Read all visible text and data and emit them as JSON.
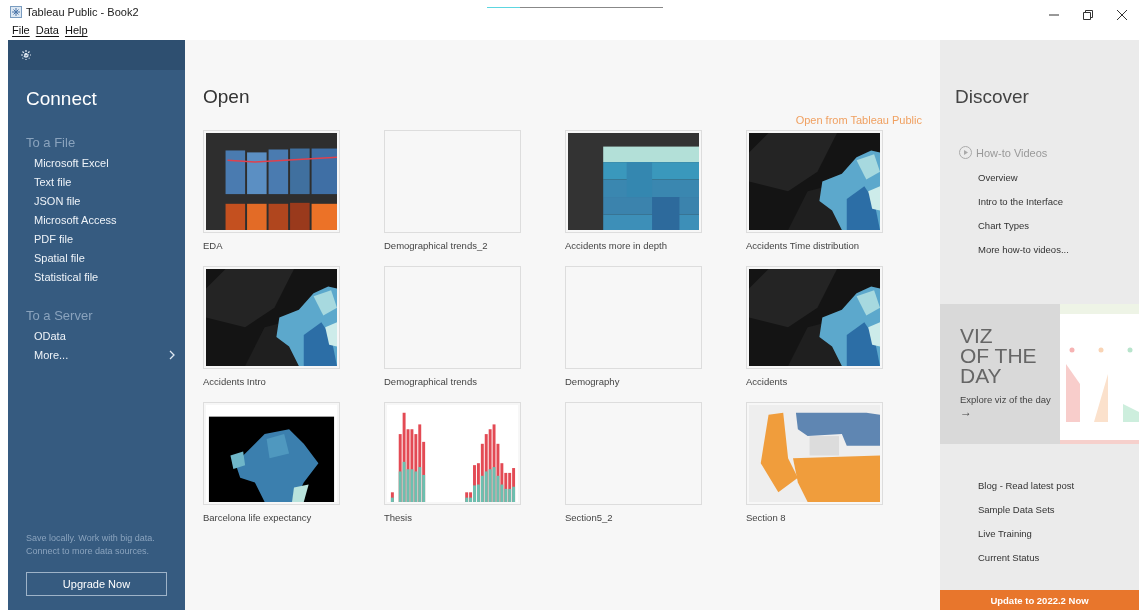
{
  "window": {
    "title": "Tableau Public - Book2"
  },
  "menu": [
    "File",
    "Data",
    "Help"
  ],
  "loading_bar": {
    "level": 0.19
  },
  "connect": {
    "title": "Connect",
    "sections": [
      {
        "heading": "To a File",
        "items": [
          {
            "label": "Microsoft Excel",
            "has_submenu": false
          },
          {
            "label": "Text file",
            "has_submenu": false
          },
          {
            "label": "JSON file",
            "has_submenu": false
          },
          {
            "label": "Microsoft Access",
            "has_submenu": false
          },
          {
            "label": "PDF file",
            "has_submenu": false
          },
          {
            "label": "Spatial file",
            "has_submenu": false
          },
          {
            "label": "Statistical file",
            "has_submenu": false
          }
        ]
      },
      {
        "heading": "To a Server",
        "items": [
          {
            "label": "OData",
            "has_submenu": false
          },
          {
            "label": "More...",
            "has_submenu": true
          }
        ]
      }
    ],
    "promo": "Save locally. Work with big data. Connect to more data sources.",
    "upgrade_button": "Upgrade Now"
  },
  "open": {
    "title": "Open",
    "link": "Open from Tableau Public",
    "workbooks": [
      {
        "name": "EDA",
        "kind": "picture"
      },
      {
        "name": "Demographical trends_2"
      },
      {
        "name": "Accidents more in depth",
        "kind": "picture"
      },
      {
        "name": "Accidents Time distribution",
        "kind": "picture"
      },
      {
        "name": "Accidents Intro",
        "kind": "picture"
      },
      {
        "name": "Demographical trends"
      },
      {
        "name": "Demography"
      },
      {
        "name": "Accidents",
        "kind": "picture"
      },
      {
        "name": "Barcelona life expectancy",
        "kind": "picture"
      },
      {
        "name": "Thesis",
        "kind": "picture"
      },
      {
        "name": "Section5_2"
      },
      {
        "name": "Section 8",
        "kind": "picture"
      }
    ]
  },
  "discover": {
    "title": "Discover",
    "videos_heading": "How-to Videos",
    "videos": [
      "Overview",
      "Intro to the Interface",
      "Chart Types",
      "More how-to videos..."
    ],
    "viz_of_the_day": {
      "title_lines": [
        "VIZ",
        "OF THE",
        "DAY"
      ],
      "link": "Explore viz of the day",
      "arrow": "→"
    },
    "links": [
      "Blog - Read latest post",
      "Sample Data Sets",
      "Live Training",
      "Current Status"
    ],
    "update_button": "Update to 2022.2 Now"
  }
}
